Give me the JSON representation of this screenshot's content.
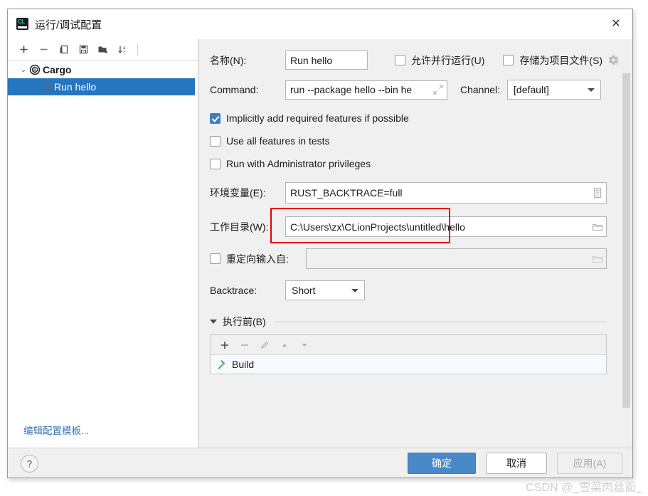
{
  "window": {
    "title": "运行/调试配置",
    "app_icon": "clion-icon",
    "close_label": "✕"
  },
  "tree_toolbar": {
    "buttons": [
      {
        "name": "add-configuration-button",
        "icon": "plus-icon",
        "label": "+"
      },
      {
        "name": "remove-configuration-button",
        "icon": "minus-icon",
        "label": "−"
      },
      {
        "name": "copy-configuration-button",
        "icon": "copy-icon",
        "label": "⧉"
      },
      {
        "name": "save-configuration-button",
        "icon": "save-icon",
        "label": "💾"
      },
      {
        "name": "move-into-folder-button",
        "icon": "folder-add-icon",
        "label": "🗀"
      },
      {
        "name": "sort-configurations-button",
        "icon": "sort-az-icon",
        "label": "↓az"
      }
    ]
  },
  "tree": {
    "items": [
      {
        "label": "Cargo",
        "icon": "rust-icon",
        "type": "group",
        "expanded": true,
        "twisty": "⌄"
      },
      {
        "label": "Run hello",
        "icon": "rust-icon",
        "type": "child",
        "selected": true
      }
    ],
    "edit_templates_link": "编辑配置模板..."
  },
  "form": {
    "name_label": "名称(N):",
    "name_value": "Run hello",
    "name_placeholder": "",
    "allow_parallel_run": {
      "label": "允许并行运行(U)",
      "checked": false
    },
    "store_as_project_file": {
      "label": "存储为项目文件(S)",
      "checked": false
    },
    "settings_gear": "gear-icon",
    "command_label": "Command:",
    "command_value": "run --package hello --bin he",
    "command_expand_icon": "expand-icon",
    "channel_label": "Channel:",
    "channel_value": "[default]",
    "implicit_features": {
      "label": "Implicitly add required features if possible",
      "checked": true
    },
    "all_features_tests": {
      "label": "Use all features in tests",
      "checked": false
    },
    "administrator": {
      "label": "Run with Administrator privileges",
      "checked": false
    },
    "env_label": "环境变量(E):",
    "env_value": "RUST_BACKTRACE=full",
    "env_browse_icon": "env-list-icon",
    "workdir_label": "工作目录(W):",
    "workdir_value": "C:\\Users\\zx\\CLionProjects\\untitled\\hello",
    "workdir_browse_icon": "folder-icon",
    "redirect_input": {
      "label": "重定向输入自:",
      "checked": false,
      "value": "",
      "browse_icon": "folder-icon"
    },
    "backtrace_label": "Backtrace:",
    "backtrace_value": "Short"
  },
  "before_launch": {
    "title": "执行前(B)",
    "collapsed": false,
    "toolbar": [
      {
        "name": "add-task-button",
        "icon": "plus-icon",
        "label": "+",
        "enabled": true
      },
      {
        "name": "remove-task-button",
        "icon": "minus-icon",
        "label": "−",
        "enabled": false
      },
      {
        "name": "edit-task-button",
        "icon": "pencil-icon",
        "label": "✎",
        "enabled": false
      },
      {
        "name": "move-task-up-button",
        "icon": "arrow-up-icon",
        "label": "▲",
        "enabled": false
      },
      {
        "name": "move-task-down-button",
        "icon": "arrow-down-icon",
        "label": "▼",
        "enabled": false
      }
    ],
    "tasks": [
      {
        "label": "Build",
        "icon": "hammer-icon"
      }
    ]
  },
  "footer": {
    "help_label": "?",
    "ok_label": "确定",
    "cancel_label": "取消",
    "apply_label": "应用(A)"
  },
  "watermark": "CSDN @_雪菜肉丝面_",
  "colors": {
    "accent_blue": "#4a89c8",
    "selection_blue": "#2675bf",
    "annotation_red": "#e60000",
    "link_blue": "#3a76b8",
    "hammer_green": "#62ab62"
  }
}
